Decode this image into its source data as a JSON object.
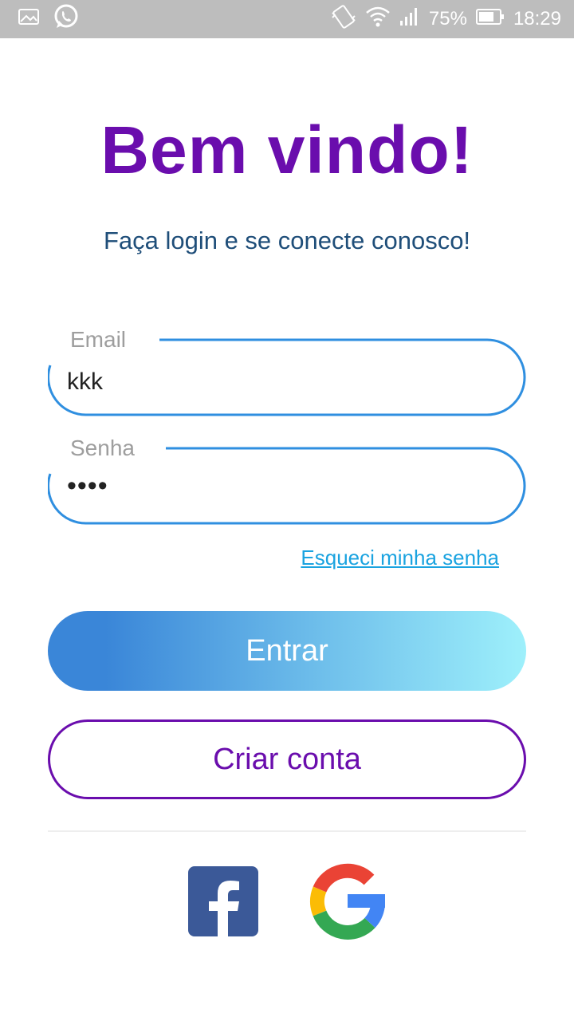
{
  "status_bar": {
    "battery": "75%",
    "time": "18:29",
    "icons": [
      "image-icon",
      "whatsapp-icon",
      "vibrate-icon",
      "wifi-icon",
      "signal-icon",
      "battery-icon"
    ]
  },
  "login": {
    "title": "Bem vindo!",
    "subtitle": "Faça login e se conecte conosco!",
    "email": {
      "label": "Email",
      "value": "kkk"
    },
    "password": {
      "label": "Senha",
      "value": "••••"
    },
    "forgot_password": "Esqueci minha senha",
    "login_button": "Entrar",
    "create_account_button": "Criar conta",
    "social": [
      "facebook-icon",
      "google-icon"
    ]
  },
  "colors": {
    "title": "#6a0dad",
    "subtitle": "#1f4e79",
    "field_border": "#2f8fe0",
    "link": "#1aa3e0",
    "outline_button": "#6a0dad"
  }
}
